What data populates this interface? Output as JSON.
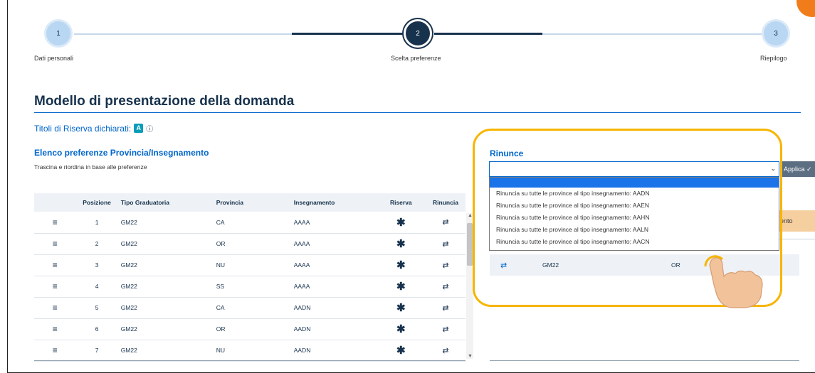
{
  "stepper": {
    "steps": [
      {
        "number": "1",
        "label": "Dati personali"
      },
      {
        "number": "2",
        "label": "Scelta preferenze"
      },
      {
        "number": "3",
        "label": "Riepilogo"
      }
    ]
  },
  "page_title": "Modello di presentazione della domanda",
  "riserva": {
    "label": "Titoli di Riserva dichiarati:",
    "badge": "A",
    "info_icon": "ⓘ"
  },
  "elenco": {
    "title": "Elenco preferenze Provincia/Insegnamento",
    "subtitle": "Trascina e riordina in base alle preferenze",
    "columns": [
      "",
      "Posizione",
      "Tipo Graduatoria",
      "Provincia",
      "Insegnamento",
      "Riserva",
      "Rinuncia"
    ],
    "rows": [
      {
        "pos": "1",
        "tipo": "GM22",
        "prov": "CA",
        "ins": "AAAA",
        "ris": "✱",
        "rin": "⇄"
      },
      {
        "pos": "2",
        "tipo": "GM22",
        "prov": "OR",
        "ins": "AAAA",
        "ris": "✱",
        "rin": "⇄"
      },
      {
        "pos": "3",
        "tipo": "GM22",
        "prov": "NU",
        "ins": "AAAA",
        "ris": "✱",
        "rin": "⇄"
      },
      {
        "pos": "4",
        "tipo": "GM22",
        "prov": "SS",
        "ins": "AAAA",
        "ris": "✱",
        "rin": "⇄"
      },
      {
        "pos": "5",
        "tipo": "GM22",
        "prov": "CA",
        "ins": "AADN",
        "ris": "✱",
        "rin": "⇄"
      },
      {
        "pos": "6",
        "tipo": "GM22",
        "prov": "OR",
        "ins": "AADN",
        "ris": "✱",
        "rin": "⇄"
      },
      {
        "pos": "7",
        "tipo": "GM22",
        "prov": "NU",
        "ins": "AADN",
        "ris": "✱",
        "rin": "⇄"
      }
    ],
    "drag_icon": "≡"
  },
  "rinunce": {
    "title": "Rinunce",
    "select_value": "",
    "applica_label": "Applica ✓",
    "options": [
      "Rinuncia su tutte le province al tipo insegnamento: AADN",
      "Rinuncia su tutte le province al tipo insegnamento: AAEN",
      "Rinuncia su tutte le province al tipo insegnamento: AAHN",
      "Rinuncia su tutte le province al tipo insegnamento: AALN",
      "Rinuncia su tutte le province al tipo insegnamento: AACN"
    ],
    "side_tab_label": "ento",
    "row": {
      "swap": "⇄",
      "tipo": "GM22",
      "prov": "OR"
    }
  }
}
